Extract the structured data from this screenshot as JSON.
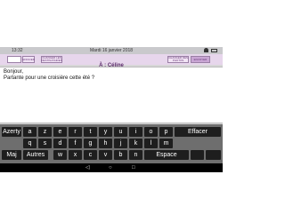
{
  "statusbar": {
    "time": "13:32",
    "date": "Mardi 16 janvier 2018"
  },
  "header": {
    "blank_button": "",
    "delete_label": "EFFACER",
    "recipients_label": "CHANGER LES DESTINATAIRES",
    "recipient": "À : Céline",
    "save_label": "CHANGER DES PHOTOS",
    "send_label": "ENVOYER"
  },
  "message": {
    "lines": [
      "Bonjour,",
      "Partante pour une croisière cette été ?"
    ]
  },
  "keyboard": {
    "row1": [
      "Azerty",
      "a",
      "z",
      "e",
      "r",
      "t",
      "y",
      "u",
      "i",
      "o",
      "p",
      "Effacer"
    ],
    "row2": [
      "q",
      "s",
      "d",
      "f",
      "g",
      "h",
      "j",
      "k",
      "l",
      "m"
    ],
    "row3": [
      "Maj",
      "Autres",
      "w",
      "x",
      "c",
      "v",
      "b",
      "n",
      "Espace",
      "",
      ""
    ]
  }
}
